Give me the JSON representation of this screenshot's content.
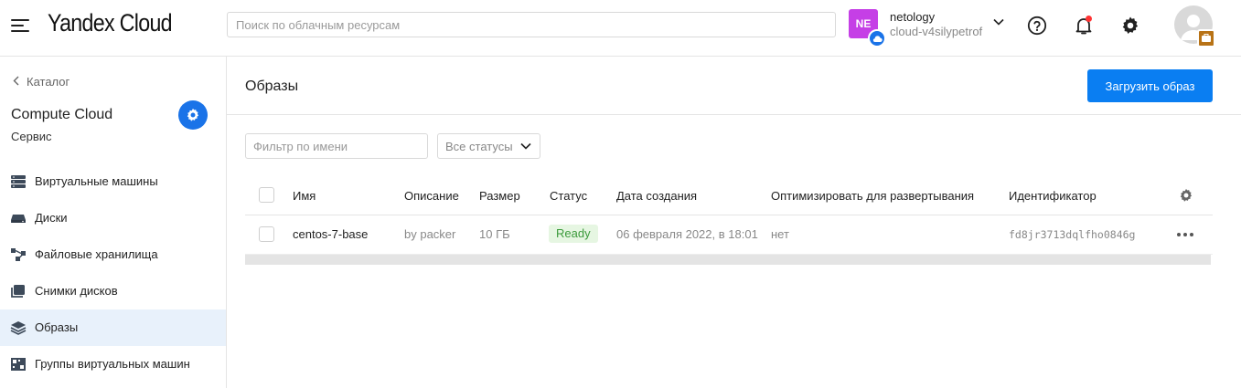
{
  "header": {
    "logo": "Yandex Cloud",
    "search_placeholder": "Поиск по облачным ресурсам",
    "cloud_badge": "NE",
    "org_name": "netology",
    "cloud_name": "cloud-v4silypetrof"
  },
  "sidebar": {
    "back_label": "Каталог",
    "service_title": "Compute Cloud",
    "service_subtitle": "Сервис",
    "items": [
      {
        "label": "Виртуальные машины",
        "icon": "servers-icon",
        "active": false
      },
      {
        "label": "Диски",
        "icon": "disk-icon",
        "active": false
      },
      {
        "label": "Файловые хранилища",
        "icon": "file-storage-icon",
        "active": false
      },
      {
        "label": "Снимки дисков",
        "icon": "snapshot-icon",
        "active": false
      },
      {
        "label": "Образы",
        "icon": "layers-icon",
        "active": true
      },
      {
        "label": "Группы виртуальных машин",
        "icon": "vm-group-icon",
        "active": false
      }
    ]
  },
  "main": {
    "title": "Образы",
    "upload_button": "Загрузить образ",
    "filter_placeholder": "Фильтр по имени",
    "status_filter": "Все статусы",
    "columns": {
      "name": "Имя",
      "description": "Описание",
      "size": "Размер",
      "status": "Статус",
      "created": "Дата создания",
      "optimize": "Оптимизировать для развертывания",
      "id": "Идентификатор"
    },
    "rows": [
      {
        "name": "centos-7-base",
        "description": "by packer",
        "size": "10 ГБ",
        "status": "Ready",
        "created": "06 февраля 2022, в 18:01",
        "optimize": "нет",
        "id": "fd8jr3713dqlfho0846g"
      }
    ]
  },
  "colors": {
    "accent": "#0a7ef2",
    "cloud_badge": "#c53fe6",
    "status_ready_bg": "#e6f6e2",
    "status_ready_text": "#3b9a3b",
    "active_nav_bg": "#e8f1fb"
  }
}
